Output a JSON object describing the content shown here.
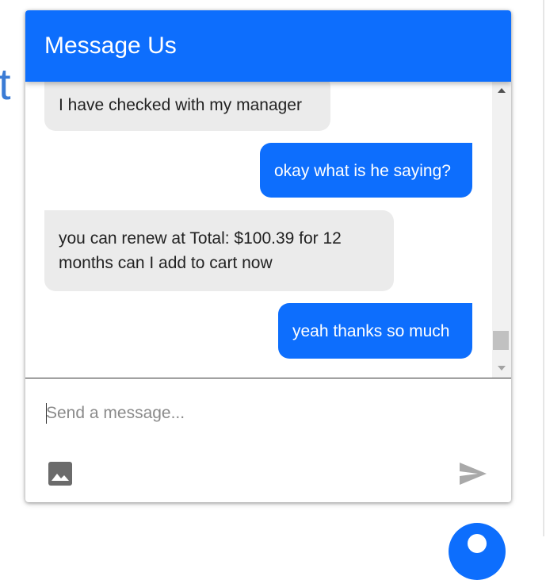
{
  "background": {
    "partial_letter": "t"
  },
  "chat": {
    "title": "Message Us",
    "messages": [
      {
        "sender": "agent",
        "text": "I have checked with my manager"
      },
      {
        "sender": "user",
        "text": "okay what is he saying?"
      },
      {
        "sender": "agent",
        "text": "you can renew at Total: $100.39 for 12 months can I add to cart now"
      },
      {
        "sender": "user",
        "text": "yeah thanks so much"
      }
    ],
    "input": {
      "placeholder": "Send a message...",
      "value": ""
    },
    "icons": {
      "attach": "image-icon",
      "send": "send-icon",
      "launcher": "chat-launcher-icon"
    },
    "colors": {
      "accent": "#0d6efd",
      "agent_bubble": "#ebebeb",
      "agent_text": "#222222",
      "user_text": "#ffffff",
      "icon_gray": "#6b6b6b",
      "send_gray": "#a9a9a9"
    }
  }
}
